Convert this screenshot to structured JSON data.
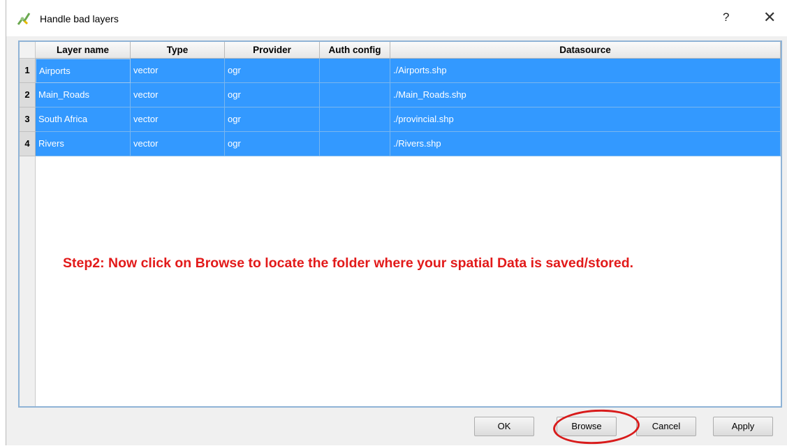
{
  "dialog": {
    "title": "Handle bad layers",
    "help_label": "?",
    "close_label": "✕"
  },
  "table": {
    "columns": [
      "Layer name",
      "Type",
      "Provider",
      "Auth config",
      "Datasource"
    ],
    "rows": [
      {
        "num": "1",
        "layer_name": "Airports",
        "type": "vector",
        "provider": "ogr",
        "auth_config": "",
        "datasource": "./Airports.shp"
      },
      {
        "num": "2",
        "layer_name": "Main_Roads",
        "type": "vector",
        "provider": "ogr",
        "auth_config": "",
        "datasource": "./Main_Roads.shp"
      },
      {
        "num": "3",
        "layer_name": "South Africa",
        "type": "vector",
        "provider": "ogr",
        "auth_config": "",
        "datasource": "./provincial.shp"
      },
      {
        "num": "4",
        "layer_name": "Rivers",
        "type": "vector",
        "provider": "ogr",
        "auth_config": "",
        "datasource": "./Rivers.shp"
      }
    ]
  },
  "annotation": {
    "text": "Step2: Now click on Browse to locate the folder where your spatial Data is saved/stored."
  },
  "buttons": {
    "ok": "OK",
    "browse": "Browse",
    "cancel": "Cancel",
    "apply": "Apply"
  },
  "colors": {
    "selection": "#3399ff",
    "annotation": "#e21a1a",
    "frame_border": "#8fb3d6"
  },
  "icons": {
    "title_icon": "qgis-logo-icon"
  }
}
